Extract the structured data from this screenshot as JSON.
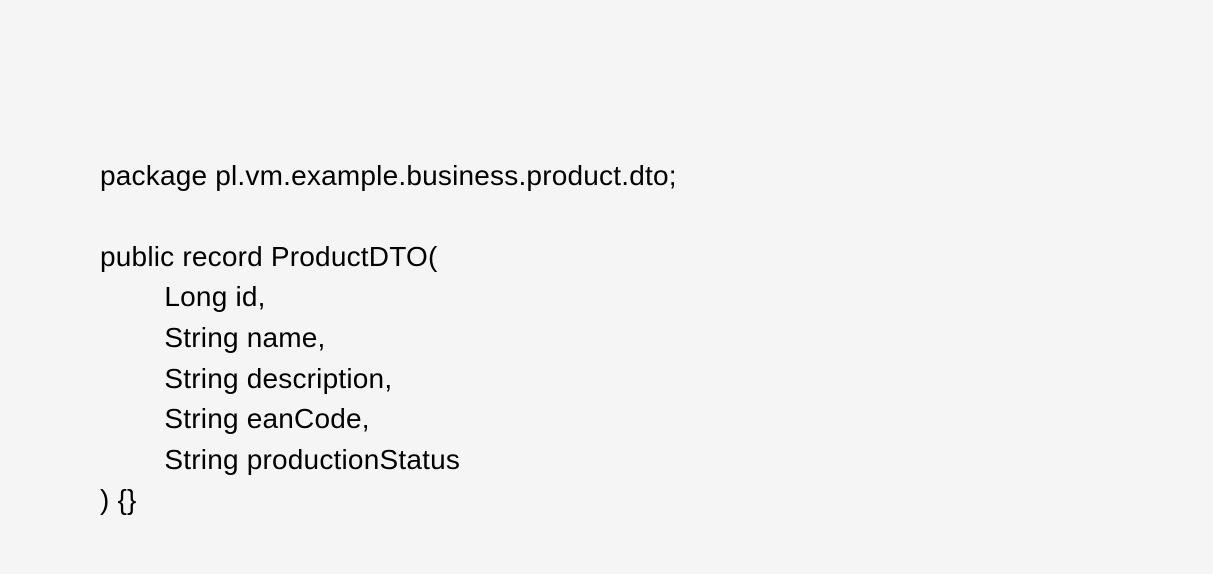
{
  "code": {
    "line1": "package pl.vm.example.business.product.dto;",
    "line2": "",
    "line3": "public record ProductDTO(",
    "line4": "Long id,",
    "line5": "String name,",
    "line6": "String description,",
    "line7": "String eanCode,",
    "line8": "String productionStatus",
    "line9": ") {}"
  }
}
